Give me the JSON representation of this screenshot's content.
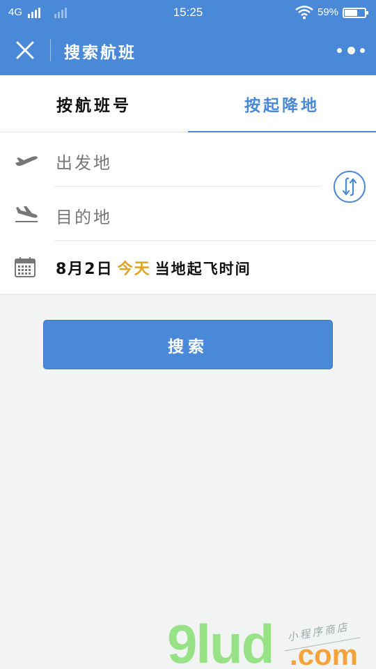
{
  "status_bar": {
    "network": "4G",
    "time": "15:25",
    "battery_percent": "59%",
    "battery_level": 0.59
  },
  "nav": {
    "title": "搜索航班"
  },
  "tabs": [
    {
      "label": "按航班号",
      "active": false
    },
    {
      "label": "按起降地",
      "active": true
    }
  ],
  "form": {
    "departure_placeholder": "出发地",
    "arrival_placeholder": "目的地",
    "date": "8月2日",
    "date_tag": "今天",
    "date_note": "当地起飞时间"
  },
  "search_button": "搜索",
  "watermark": {
    "logo": "9lud",
    "domain": ".com",
    "slogan": "小程序商店"
  },
  "colors": {
    "primary": "#4a88d8",
    "today": "#e0a323",
    "background": "#f2f4f3"
  }
}
